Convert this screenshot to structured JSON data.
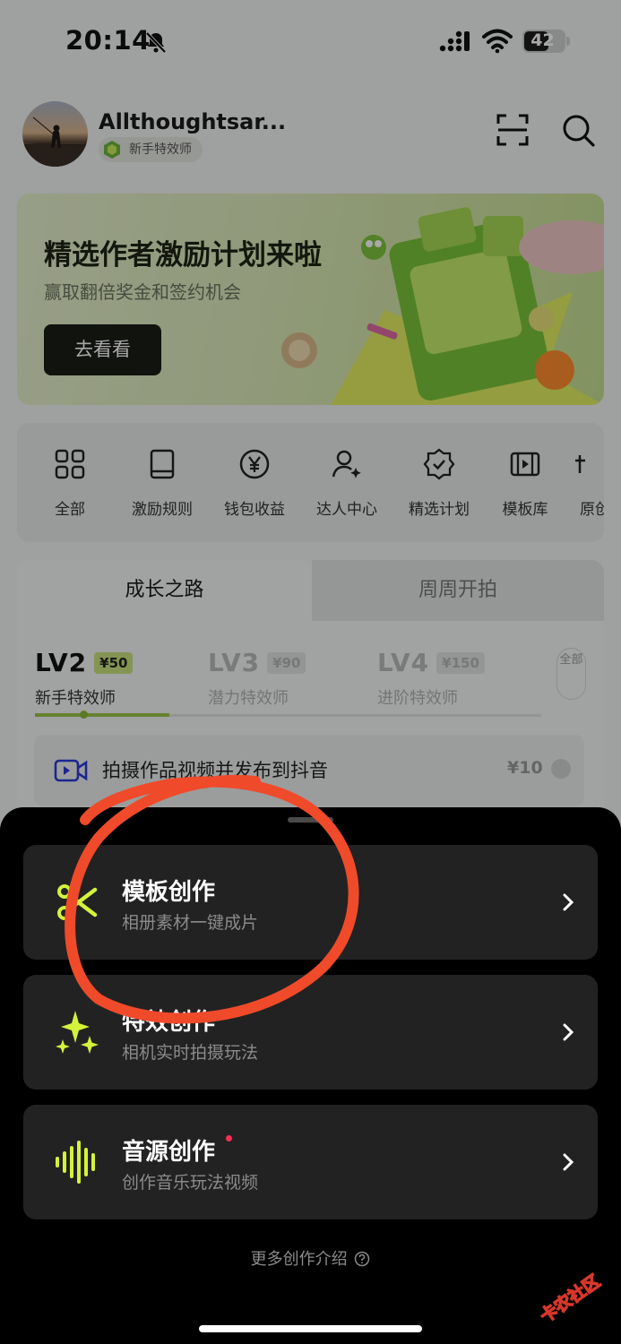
{
  "status_bar": {
    "time": "20:14",
    "battery": "42"
  },
  "profile": {
    "username": "Allthoughtsar...",
    "badge": "新手特效师"
  },
  "banner": {
    "title": "精选作者激励计划来啦",
    "subtitle": "赢取翻倍奖金和签约机会",
    "button": "去看看"
  },
  "shortcuts": [
    {
      "label": "全部",
      "icon": "grid-icon"
    },
    {
      "label": "激励规则",
      "icon": "book-icon"
    },
    {
      "label": "钱包收益",
      "icon": "yen-coin-icon"
    },
    {
      "label": "达人中心",
      "icon": "user-star-icon"
    },
    {
      "label": "精选计划",
      "icon": "verified-badge-icon"
    },
    {
      "label": "模板库",
      "icon": "film-icon"
    },
    {
      "label": "原创",
      "icon": "text-icon"
    }
  ],
  "growth": {
    "tabs": [
      "成长之路",
      "周周开拍"
    ],
    "levels": [
      {
        "level": "LV2",
        "reward": "¥50",
        "title": "新手特效师"
      },
      {
        "level": "LV3",
        "reward": "¥90",
        "title": "潜力特效师"
      },
      {
        "level": "LV4",
        "reward": "¥150",
        "title": "进阶特效师"
      }
    ],
    "all_button": "全部",
    "task": {
      "text": "拍摄作品视频并发布到抖音",
      "reward": "¥10"
    }
  },
  "sheet": {
    "options": [
      {
        "title": "模板创作",
        "subtitle": "相册素材一键成片",
        "icon": "scissors-icon"
      },
      {
        "title": "特效创作",
        "subtitle": "相机实时拍摄玩法",
        "icon": "sparkles-icon"
      },
      {
        "title": "音源创作",
        "subtitle": "创作音乐玩法视频",
        "icon": "soundwave-icon"
      }
    ],
    "more_link": "更多创作介绍",
    "accent_color": "#d4f23a"
  },
  "watermark": "卡农社区"
}
